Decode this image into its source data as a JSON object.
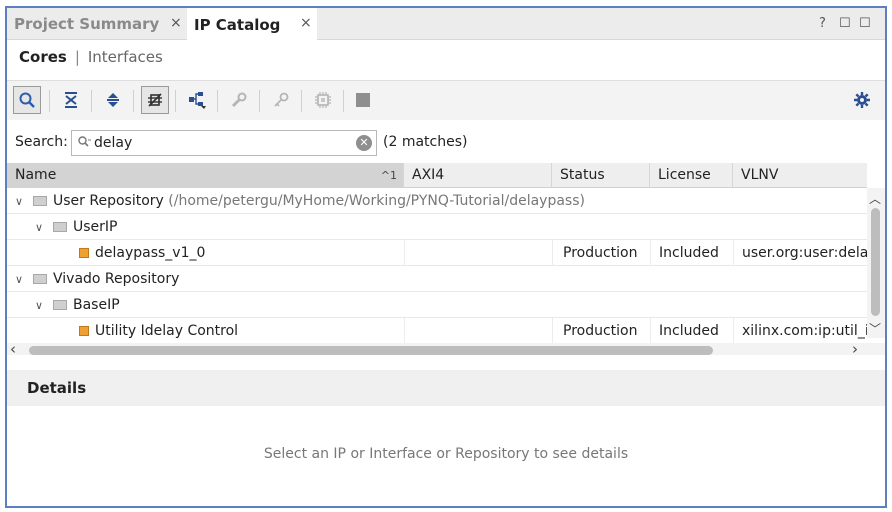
{
  "tabs": [
    {
      "label": "Project Summary",
      "active": false,
      "close": "×"
    },
    {
      "label": "IP Catalog",
      "active": true,
      "close": "×"
    }
  ],
  "window_controls": {
    "help": "?",
    "restore": "☐",
    "maximize": "☐"
  },
  "subtabs": {
    "cores": "Cores",
    "separator": "|",
    "interfaces": "Interfaces"
  },
  "toolbar": {
    "buttons": [
      "search-icon",
      "collapse-all-icon",
      "expand-all-icon",
      "filter-icon",
      "hierarchy-icon",
      "wrench-icon",
      "key-icon",
      "chip-icon",
      "stop-icon"
    ],
    "settings": "gear-icon"
  },
  "search": {
    "label": "Search:",
    "value": "delay",
    "match_count": "(2 matches)"
  },
  "table": {
    "columns": [
      "Name",
      "AXI4",
      "Status",
      "License",
      "VLNV"
    ],
    "sort_indicator": "1",
    "rows": [
      {
        "level": 0,
        "type": "repository",
        "name": "User Repository",
        "path": "(/home/petergu/MyHome/Working/PYNQ-Tutorial/delaypass)",
        "axi4": "",
        "status": "",
        "license": "",
        "vlnv": ""
      },
      {
        "level": 1,
        "type": "group",
        "name": "UserIP",
        "path": "",
        "axi4": "",
        "status": "",
        "license": "",
        "vlnv": ""
      },
      {
        "level": 2,
        "type": "ip",
        "name": "delaypass_v1_0",
        "path": "",
        "axi4": "",
        "status": "Production",
        "license": "Included",
        "vlnv": "user.org:user:delaypass"
      },
      {
        "level": 0,
        "type": "repository",
        "name": "Vivado Repository",
        "path": "",
        "axi4": "",
        "status": "",
        "license": "",
        "vlnv": ""
      },
      {
        "level": 1,
        "type": "group",
        "name": "BaseIP",
        "path": "",
        "axi4": "",
        "status": "",
        "license": "",
        "vlnv": ""
      },
      {
        "level": 2,
        "type": "ip",
        "name": "Utility Idelay Control",
        "path": "",
        "axi4": "",
        "status": "Production",
        "license": "Included",
        "vlnv": "xilinx.com:ip:util_idelay_ctrl"
      }
    ]
  },
  "details": {
    "title": "Details",
    "empty_message": "Select an IP or Interface or Repository to see details"
  },
  "colors": {
    "frame_border": "#5b7fbf",
    "header_sorted": "#d3d3d3",
    "ip_icon": "#f0a030"
  }
}
